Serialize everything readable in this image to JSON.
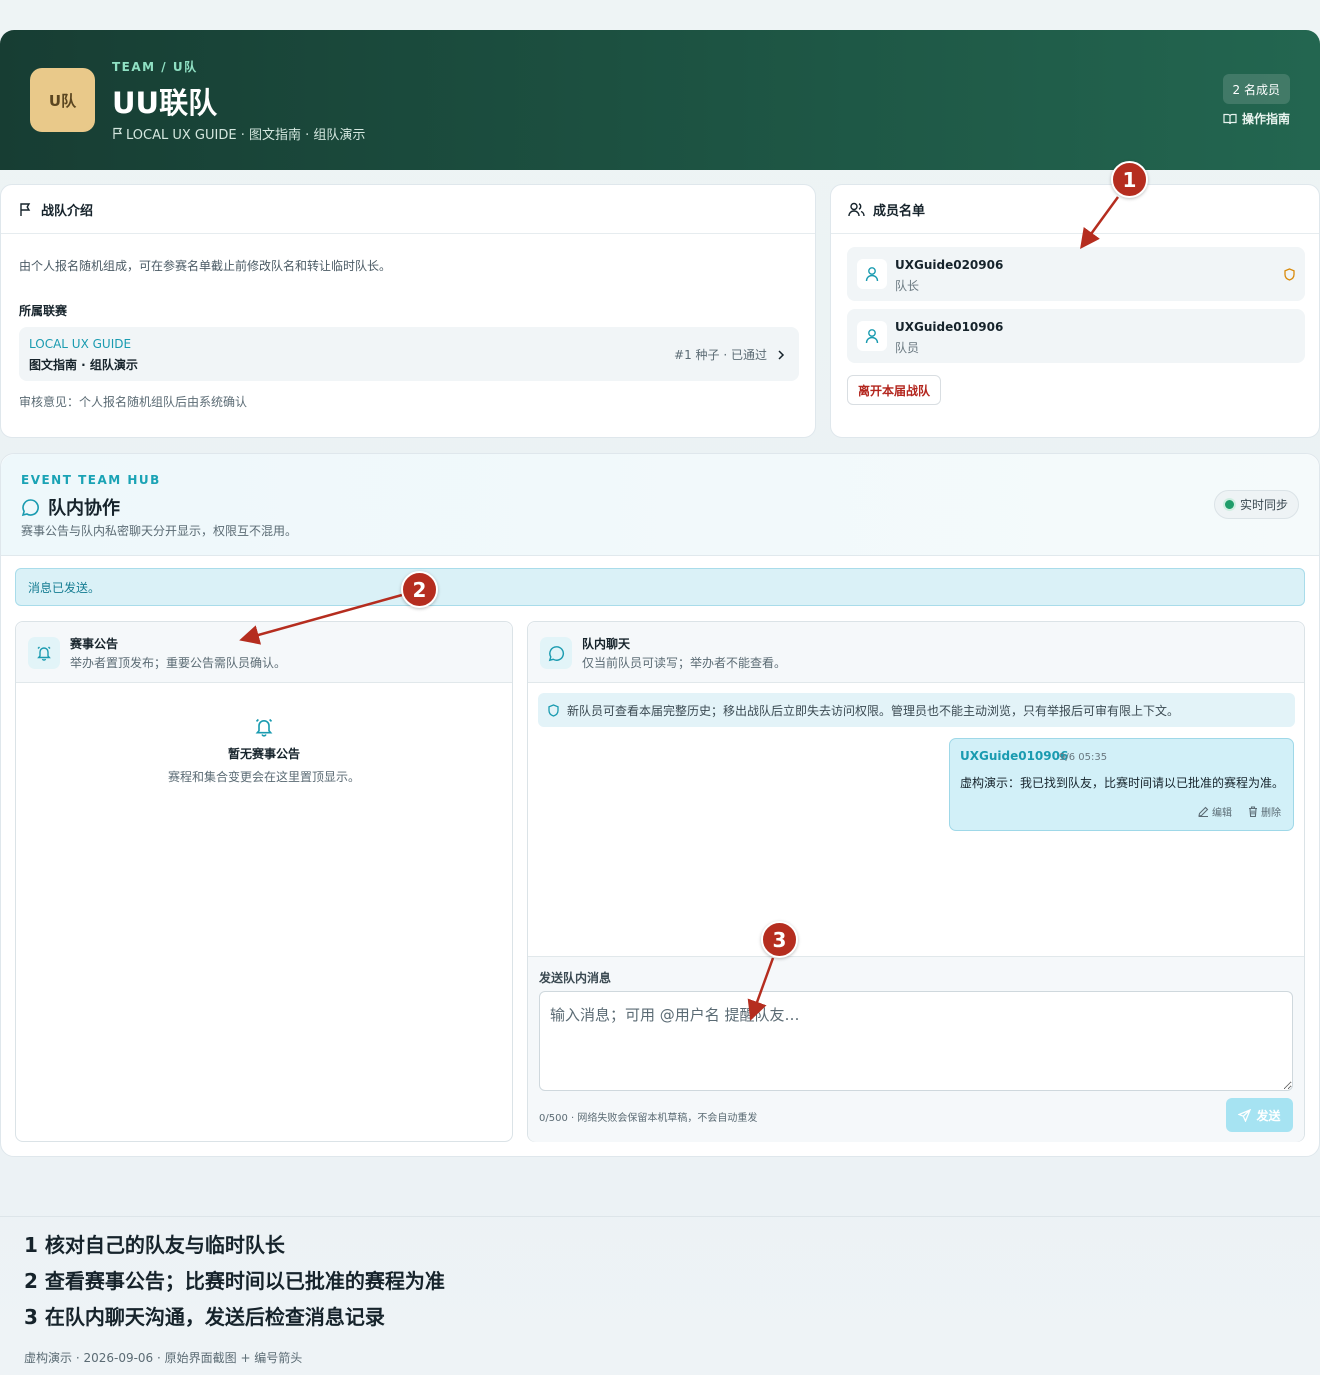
{
  "header": {
    "avatar_text": "U队",
    "breadcrumb": "TEAM / U队",
    "team_name": "UU联队",
    "subtitle": "LOCAL UX GUIDE · 图文指南 · 组队演示",
    "member_count": "2 名成员",
    "guide_link": "操作指南",
    "colors": {
      "banner": "#1d5443",
      "avatar": "#e9c98a"
    }
  },
  "intro": {
    "title": "战队介绍",
    "description": "由个人报名随机组成，可在参赛名单截止前修改队名和转让临时队长。",
    "league_label": "所属联赛",
    "league_name": "LOCAL UX GUIDE",
    "league_sub": "图文指南 · 组队演示",
    "league_status": "#1 种子 · 已通过",
    "review": "审核意见：个人报名随机组队后由系统确认"
  },
  "members": {
    "title": "成员名单",
    "items": [
      {
        "name": "UXGuide020906",
        "role": "队长",
        "badge_icon": "shield-icon"
      },
      {
        "name": "UXGuide010906",
        "role": "队员"
      }
    ],
    "leave_button": "离开本届战队"
  },
  "hub": {
    "kicker": "EVENT TEAM HUB",
    "title": "队内协作",
    "subtitle": "赛事公告与队内私密聊天分开显示，权限互不混用。",
    "sync_label": "实时同步",
    "sent_notice": "消息已发送。"
  },
  "announcements": {
    "title": "赛事公告",
    "subtitle": "举办者置顶发布；重要公告需队员确认。",
    "empty_title": "暂无赛事公告",
    "empty_sub": "赛程和集合变更会在这里置顶显示。"
  },
  "chat": {
    "title": "队内聊天",
    "subtitle": "仅当前队员可读写；举办者不能查看。",
    "privacy_notice": "新队员可查看本届完整历史；移出战队后立即失去访问权限。管理员也不能主动浏览，只有举报后可审有限上下文。",
    "messages": [
      {
        "author": "UXGuide010906",
        "time": "9/6 05:35",
        "text": "虚构演示：我已找到队友，比赛时间请以已批准的赛程为准。",
        "edit_label": "编辑",
        "delete_label": "删除"
      }
    ],
    "composer_label": "发送队内消息",
    "composer_placeholder": "输入消息；可用 @用户名 提醒队友…",
    "composer_value": "",
    "hint": "0/500 · 网络失败会保留本机草稿，不会自动重发",
    "send_label": "发送"
  },
  "markers": [
    "1",
    "2",
    "3"
  ],
  "steps": [
    "1 核对自己的队友与临时队长",
    "2 查看赛事公告；比赛时间以已批准的赛程为准",
    "3 在队内聊天沟通，发送后检查消息记录"
  ],
  "caption": "虚构演示 · 2026-09-06 · 原始界面截图 + 编号箭头",
  "accent_colors": {
    "teal": "#1a9bb0",
    "marker": "#b52d1f",
    "danger": "#b3261e"
  }
}
